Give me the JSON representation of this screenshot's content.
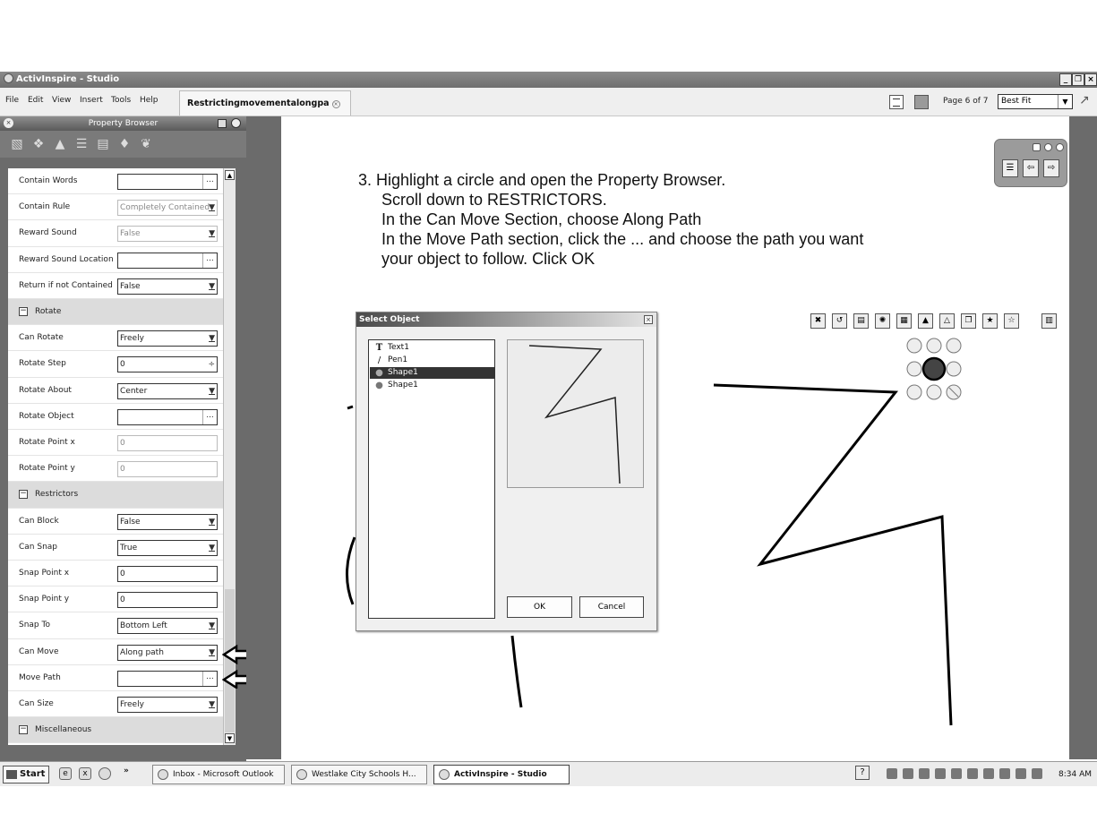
{
  "window": {
    "title": "ActivInspire - Studio",
    "controls": [
      "_",
      "×"
    ]
  },
  "menubar": {
    "items": [
      "File",
      "Edit",
      "View",
      "Insert",
      "Tools",
      "Help"
    ],
    "doc_tab": "Restrictingmovementalongpa",
    "page_label": "Page 6 of 7",
    "zoom": "Best Fit"
  },
  "property_browser": {
    "title": "Property Browser",
    "rows": [
      {
        "type": "field",
        "label": "Contain Words",
        "value": "",
        "control": "dots"
      },
      {
        "type": "field",
        "label": "Contain Rule",
        "value": "Completely Contained",
        "control": "dropdown",
        "grey": true
      },
      {
        "type": "field",
        "label": "Reward Sound",
        "value": "False",
        "control": "dropdown",
        "grey": true
      },
      {
        "type": "field",
        "label": "Reward Sound Location",
        "value": "",
        "control": "dots"
      },
      {
        "type": "field",
        "label": "Return if not Contained",
        "value": "False",
        "control": "dropdown"
      },
      {
        "type": "section",
        "label": "Rotate"
      },
      {
        "type": "field",
        "label": "Can Rotate",
        "value": "Freely",
        "control": "dropdown"
      },
      {
        "type": "field",
        "label": "Rotate Step",
        "value": "0",
        "control": "spin"
      },
      {
        "type": "field",
        "label": "Rotate About",
        "value": "Center",
        "control": "dropdown"
      },
      {
        "type": "field",
        "label": "Rotate Object",
        "value": "",
        "control": "dots"
      },
      {
        "type": "field",
        "label": "Rotate Point x",
        "value": "0",
        "control": "none",
        "grey": true
      },
      {
        "type": "field",
        "label": "Rotate Point y",
        "value": "0",
        "control": "none",
        "grey": true
      },
      {
        "type": "section",
        "label": "Restrictors"
      },
      {
        "type": "field",
        "label": "Can Block",
        "value": "False",
        "control": "dropdown"
      },
      {
        "type": "field",
        "label": "Can Snap",
        "value": "True",
        "control": "dropdown"
      },
      {
        "type": "field",
        "label": "Snap Point x",
        "value": "0",
        "control": "none"
      },
      {
        "type": "field",
        "label": "Snap Point y",
        "value": "0",
        "control": "none"
      },
      {
        "type": "field",
        "label": "Snap To",
        "value": "Bottom Left",
        "control": "dropdown"
      },
      {
        "type": "field",
        "label": "Can Move",
        "value": "Along path",
        "control": "dropdown"
      },
      {
        "type": "field",
        "label": "Move Path",
        "value": "",
        "control": "dots"
      },
      {
        "type": "field",
        "label": "Can Size",
        "value": "Freely",
        "control": "dropdown"
      },
      {
        "type": "section",
        "label": "Miscellaneous"
      }
    ]
  },
  "instructions": [
    "3. Highlight a circle and open the Property Browser.",
    "Scroll down to RESTRICTORS.",
    "In the Can Move Section, choose Along Path",
    "In the Move Path section, click the ... and choose the path you want",
    "your object to follow.  Click OK"
  ],
  "dialog": {
    "title": "Select Object",
    "objects": [
      {
        "name": "Text1",
        "icon": "text-icon",
        "selected": false
      },
      {
        "name": "Pen1",
        "icon": "pen-icon",
        "selected": false
      },
      {
        "name": "Shape1",
        "icon": "shape-icon",
        "selected": true
      },
      {
        "name": "Shape1",
        "icon": "shape-icon",
        "selected": false
      }
    ],
    "ok_label": "OK",
    "cancel_label": "Cancel"
  },
  "taskbar": {
    "start_label": "Start",
    "tasks": [
      "Inbox - Microsoft Outlook",
      "Westlake City Schools H...",
      "ActivInspire - Studio"
    ],
    "active_task": "ActivInspire - Studio",
    "clock": "8:34 AM"
  },
  "colors": {
    "panel_bg": "#6b6b6b",
    "title_bar": "#7a7a7a",
    "selected": "#333333"
  }
}
